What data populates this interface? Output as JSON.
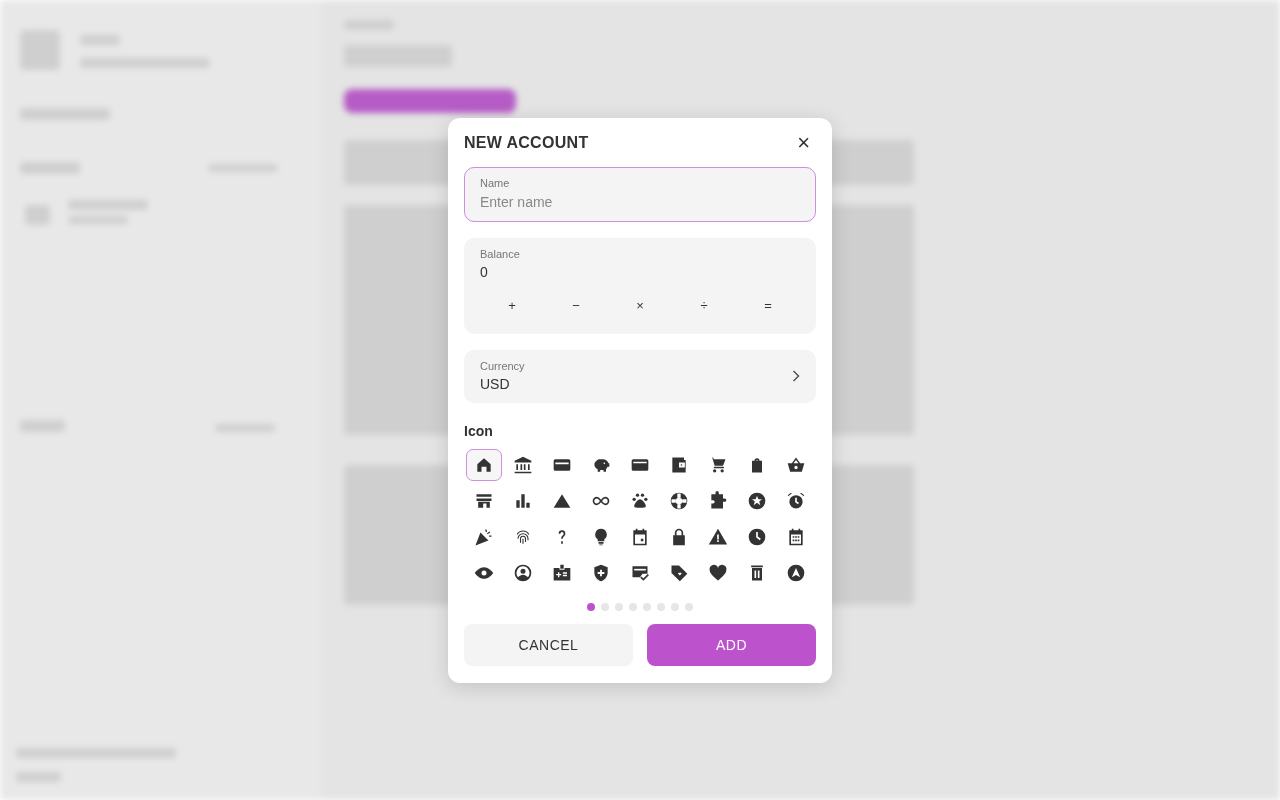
{
  "dialog": {
    "title": "NEW ACCOUNT",
    "close": "×",
    "name_field": {
      "label": "Name",
      "placeholder": "Enter name"
    },
    "balance_field": {
      "label": "Balance",
      "value": "0",
      "keys": [
        "+",
        "−",
        "×",
        "÷",
        "="
      ]
    },
    "currency_field": {
      "label": "Currency",
      "value": "USD"
    },
    "icon_section": {
      "label": "Icon",
      "icons": [
        {
          "selected": true
        },
        {
          "selected": false
        },
        {
          "selected": false
        },
        {
          "selected": false
        },
        {
          "selected": false
        },
        {
          "selected": false
        },
        {
          "selected": false
        },
        {
          "selected": false
        },
        {
          "selected": false
        },
        {
          "selected": false
        },
        {
          "selected": false
        },
        {
          "selected": false
        },
        {
          "selected": false
        },
        {
          "selected": false
        },
        {
          "selected": false
        },
        {
          "selected": false
        },
        {
          "selected": false
        },
        {
          "selected": false
        },
        {
          "selected": false
        },
        {
          "selected": false
        },
        {
          "selected": false
        },
        {
          "selected": false
        },
        {
          "selected": false
        },
        {
          "selected": false
        },
        {
          "selected": false
        },
        {
          "selected": false
        },
        {
          "selected": false
        },
        {
          "selected": false
        },
        {
          "selected": false
        },
        {
          "selected": false
        },
        {
          "selected": false
        },
        {
          "selected": false
        },
        {
          "selected": false
        },
        {
          "selected": false
        },
        {
          "selected": false
        },
        {
          "selected": false
        }
      ],
      "pages": [
        {
          "selected": true
        },
        {
          "selected": false
        },
        {
          "selected": false
        },
        {
          "selected": false
        },
        {
          "selected": false
        },
        {
          "selected": false
        },
        {
          "selected": false
        },
        {
          "selected": false
        }
      ]
    },
    "buttons": [
      {
        "label": "CANCEL",
        "kind": "secondary"
      },
      {
        "label": "ADD",
        "kind": "primary"
      }
    ]
  }
}
